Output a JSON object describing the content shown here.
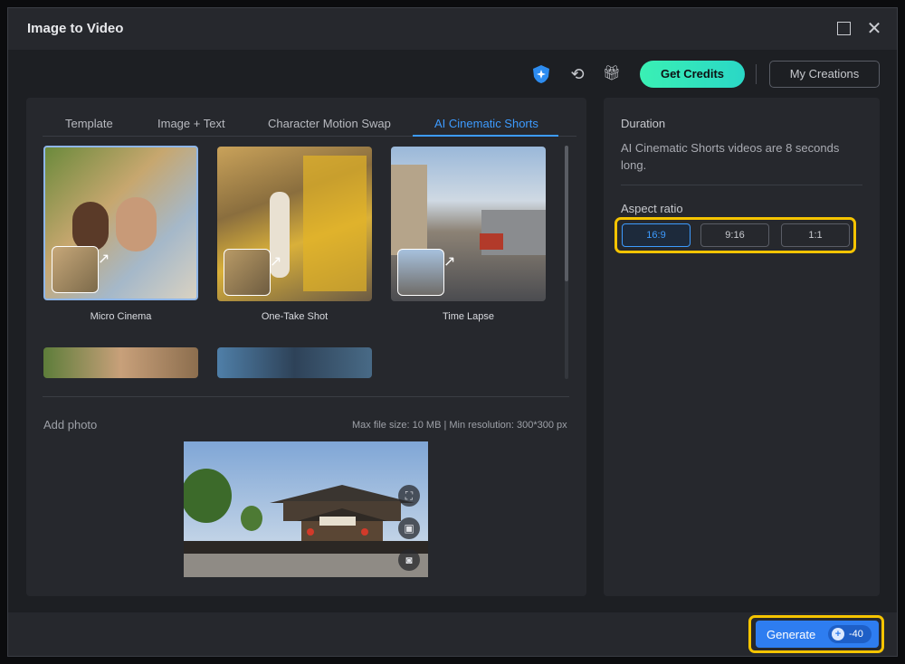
{
  "window": {
    "title": "Image to Video",
    "maximize_icon": "maximize-icon",
    "close_icon": "close-icon"
  },
  "toolbar": {
    "get_credits": "Get Credits",
    "my_creations": "My Creations",
    "icons": [
      "shield-sparkle-icon",
      "refresh-icon",
      "gift-icon"
    ]
  },
  "tabs": [
    {
      "label": "Template",
      "active": false
    },
    {
      "label": "Image + Text",
      "active": false
    },
    {
      "label": "Character Motion Swap",
      "active": false
    },
    {
      "label": "AI Cinematic Shorts",
      "active": true
    }
  ],
  "templates": [
    {
      "label": "Micro Cinema",
      "selected": true
    },
    {
      "label": "One-Take Shot",
      "selected": false
    },
    {
      "label": "Time Lapse",
      "selected": false
    }
  ],
  "photo": {
    "label": "Add photo",
    "limits": "Max file size: 10 MB | Min resolution: 300*300 px",
    "tools": [
      "crop-icon",
      "replace-image-icon",
      "portrait-icon"
    ]
  },
  "settings": {
    "duration_label": "Duration",
    "duration_text": "AI Cinematic Shorts videos are 8 seconds long.",
    "aspect_label": "Aspect ratio",
    "aspect_options": [
      "16:9",
      "9:16",
      "1:1"
    ],
    "aspect_selected": "16:9"
  },
  "footer": {
    "generate_label": "Generate",
    "credit_cost": "-40"
  },
  "colors": {
    "accent": "#3d9bff",
    "credits_button": "#3af0b4",
    "generate_button": "#2e7df0",
    "highlight": "#f5c400"
  }
}
